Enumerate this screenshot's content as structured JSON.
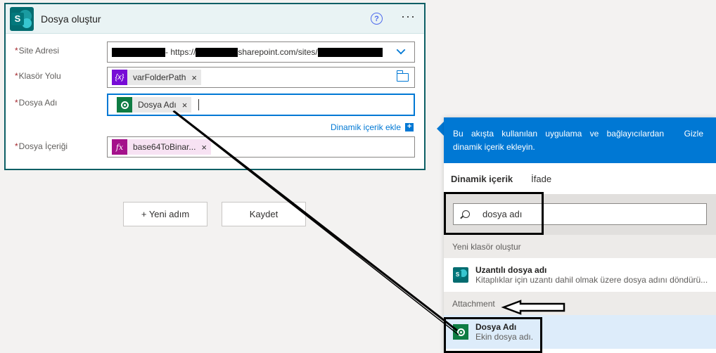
{
  "card": {
    "title": "Dosya oluştur",
    "help_glyph": "?",
    "more_glyph": "···",
    "fields": [
      {
        "label": "Site Adresi",
        "required_mark": "*",
        "value_visible": "- https://",
        "value_visible_2": "sharepoint.com/sites/"
      },
      {
        "label": "Klasör Yolu",
        "required_mark": "*",
        "token": "varFolderPath",
        "token_icon": "{x}"
      },
      {
        "label": "Dosya Adı",
        "required_mark": "*",
        "token": "Dosya Adı"
      },
      {
        "label": "Dosya İçeriği",
        "required_mark": "*",
        "token": "base64ToBinar...",
        "token_icon": "fx"
      }
    ],
    "token_remove_glyph": "×",
    "dynamic_link": "Dinamik içerik ekle",
    "dynamic_link_plus": "+"
  },
  "buttons": {
    "new_step": "+ Yeni adım",
    "save": "Kaydet"
  },
  "panel": {
    "message": "Bu akışta kullanılan uygulama ve bağlayıcılardan dinamik içerik ekleyin.",
    "hide": "Gizle",
    "tabs": [
      "Dinamik içerik",
      "İfade"
    ],
    "search_value": "dosya adı",
    "sections": [
      {
        "title": "Yeni klasör oluştur",
        "items": [
          {
            "title": "Uzantılı dosya adı",
            "description": "Kitaplıklar için uzantı dahil olmak üzere dosya adını döndürü...",
            "icon": "sharepoint-icon"
          }
        ]
      },
      {
        "title": "Attachment",
        "items": [
          {
            "title": "Dosya Adı",
            "description": "Ekin dosya adı.",
            "icon": "dataverse-icon"
          }
        ]
      }
    ]
  },
  "colors": {
    "accent": "#0078d4",
    "card_border": "#0d5f65",
    "required": "#a4262c"
  }
}
